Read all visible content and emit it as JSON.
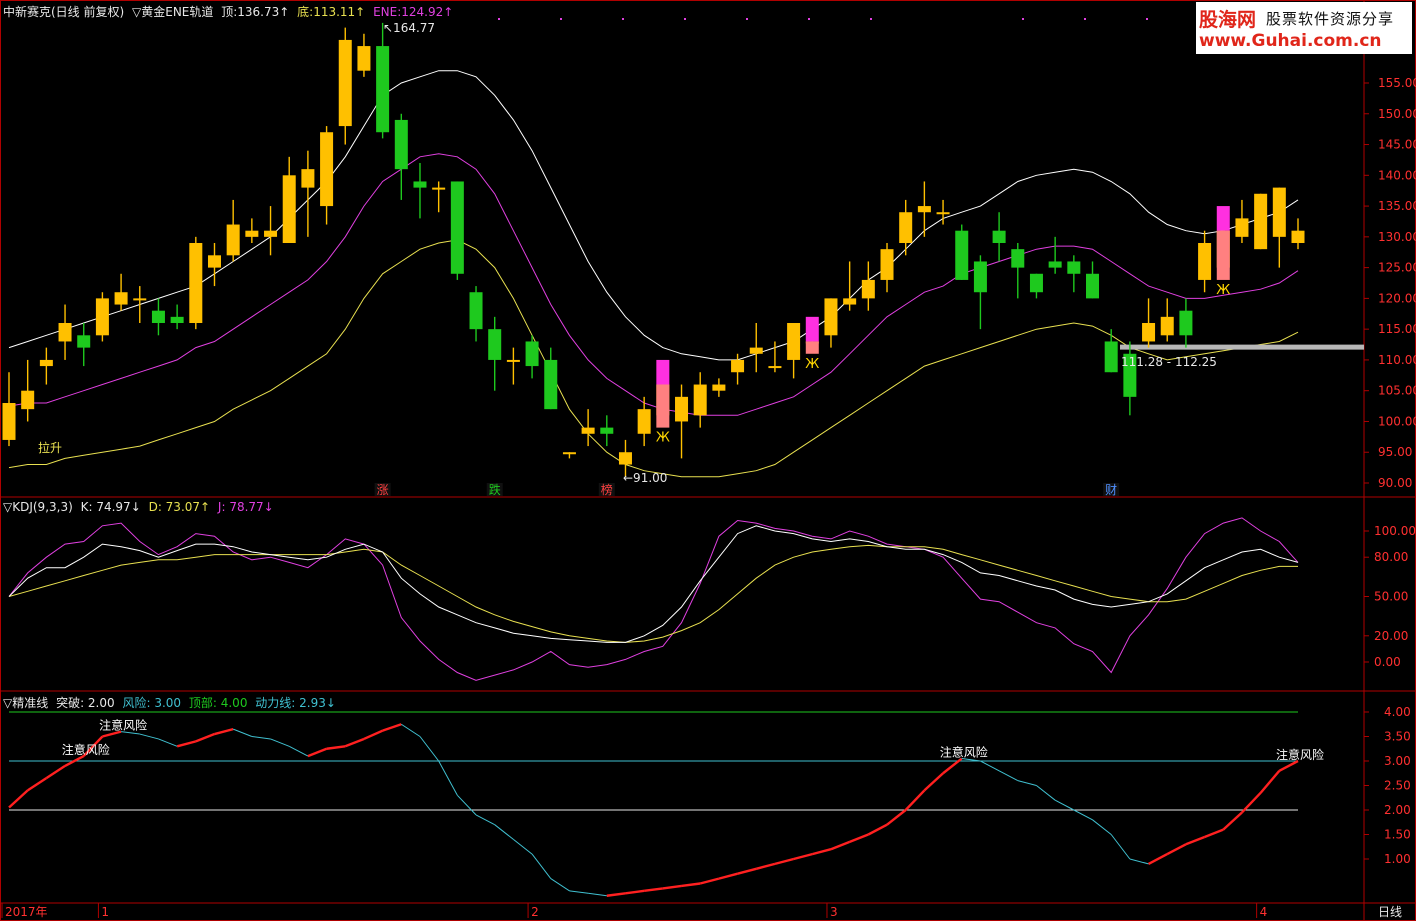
{
  "header": {
    "title": "中新赛克(日线 前复权)",
    "indicator": "▽黄金ENE轨道",
    "top_label": "顶:",
    "top_value": "136.73↑",
    "bottom_label": "底:",
    "bottom_value": "113.11↑",
    "ene_label": "ENE:",
    "ene_value": "124.92↑"
  },
  "logo": {
    "name": "股海网",
    "slogan": "股票软件资源分享",
    "url": "www.Guhai.com.cn"
  },
  "kdj_header": {
    "name": "▽KDJ(9,3,3)",
    "k": "K: 74.97↓",
    "d": "D: 73.07↑",
    "j": "J: 78.77↓"
  },
  "line_header": {
    "name": "▽精准线",
    "break": "突破: 2.00",
    "risk": "风险: 3.00",
    "top": "顶部: 4.00",
    "power": "动力线: 2.93↓"
  },
  "colors": {
    "up": "#ffc000",
    "down": "#1ec91e",
    "upper": "#ffffff",
    "mid": "#e040e0",
    "lower": "#e8e050",
    "kdj_k": "#ffffff",
    "kdj_d": "#e8e050",
    "kdj_j": "#e040e0",
    "line_up": "#ff2020",
    "line_down": "#40c0d0"
  },
  "chart_data": [
    {
      "type": "candlestick",
      "ylim": [
        88,
        165
      ],
      "yticks": [
        90,
        95,
        100,
        105,
        110,
        115,
        120,
        125,
        130,
        135,
        140,
        145,
        150,
        155
      ],
      "candles": [
        [
          97,
          103,
          96,
          108
        ],
        [
          102,
          105,
          100,
          110
        ],
        [
          109,
          110,
          106,
          112
        ],
        [
          113,
          116,
          110,
          119
        ],
        [
          114,
          112,
          109,
          116
        ],
        [
          114,
          120,
          113,
          121
        ],
        [
          119,
          121,
          118,
          124
        ],
        [
          120,
          120,
          116,
          122
        ],
        [
          118,
          116,
          114,
          120
        ],
        [
          117,
          116,
          115,
          119
        ],
        [
          116,
          129,
          115,
          130
        ],
        [
          125,
          127,
          122,
          129
        ],
        [
          127,
          132,
          126,
          136
        ],
        [
          130,
          131,
          129,
          133
        ],
        [
          130,
          131,
          127,
          135
        ],
        [
          129,
          140,
          129,
          143
        ],
        [
          138,
          141,
          130,
          144
        ],
        [
          135,
          147,
          132,
          148
        ],
        [
          148,
          162,
          145,
          164
        ],
        [
          157,
          161,
          156,
          163
        ],
        [
          161,
          147,
          146,
          164.77
        ],
        [
          149,
          141,
          136,
          150
        ],
        [
          139,
          138,
          133,
          142
        ],
        [
          138,
          138,
          134,
          139
        ],
        [
          139,
          124,
          123,
          139
        ],
        [
          121,
          115,
          113,
          122
        ],
        [
          115,
          110,
          105,
          117
        ],
        [
          110,
          110,
          106,
          112
        ],
        [
          113,
          109,
          107,
          114
        ],
        [
          110,
          102,
          102,
          112
        ],
        [
          95,
          95,
          94,
          95
        ],
        [
          98,
          99,
          96,
          102
        ],
        [
          99,
          98,
          96,
          101
        ],
        [
          93,
          95,
          91,
          97
        ],
        [
          98,
          102,
          96,
          104
        ],
        [
          101,
          106,
          100,
          106
        ],
        [
          100,
          104,
          94,
          106
        ],
        [
          101,
          106,
          99,
          108
        ],
        [
          105,
          106,
          104,
          107
        ],
        [
          108,
          110,
          106,
          111
        ],
        [
          111,
          112,
          108,
          116
        ],
        [
          109,
          109,
          108,
          113
        ],
        [
          110,
          116,
          107,
          116
        ],
        [
          113,
          113,
          112,
          114
        ],
        [
          114,
          120,
          112,
          120
        ],
        [
          119,
          120,
          118,
          126
        ],
        [
          120,
          123,
          118,
          126
        ],
        [
          123,
          128,
          121,
          129
        ],
        [
          129,
          134,
          127,
          136
        ],
        [
          134,
          135,
          130,
          139
        ],
        [
          134,
          134,
          132,
          136
        ],
        [
          131,
          123,
          123,
          132
        ],
        [
          126,
          121,
          115,
          127
        ],
        [
          131,
          129,
          126,
          134
        ],
        [
          128,
          125,
          120,
          129
        ],
        [
          124,
          121,
          120,
          124
        ],
        [
          126,
          125,
          124,
          130
        ],
        [
          126,
          124,
          121,
          127
        ],
        [
          124,
          120,
          120,
          126
        ],
        [
          113,
          108,
          108,
          115
        ],
        [
          111,
          104,
          101,
          113
        ],
        [
          113,
          116,
          112,
          120
        ],
        [
          114,
          117,
          113,
          120
        ],
        [
          118,
          114,
          112,
          120
        ],
        [
          123,
          129,
          121,
          131
        ],
        [
          125,
          131,
          124,
          132
        ],
        [
          130,
          133,
          129,
          136
        ],
        [
          128,
          137,
          128,
          137
        ],
        [
          130,
          138,
          125,
          138
        ],
        [
          129,
          131,
          128,
          133
        ]
      ],
      "upper_line": [
        112,
        113,
        114,
        115,
        116,
        117,
        118,
        119,
        120,
        121,
        122,
        124,
        126,
        128,
        130,
        133,
        136,
        139,
        143,
        148,
        153,
        155,
        156,
        157,
        157,
        156,
        153,
        149,
        144,
        138,
        132,
        126,
        121,
        117,
        114,
        112,
        111,
        110.5,
        110,
        110,
        111,
        112,
        113,
        115,
        117,
        120,
        123,
        125,
        128,
        131,
        133,
        134,
        135,
        137,
        139,
        140,
        140.5,
        141,
        140.5,
        139,
        137,
        134,
        132,
        131,
        130.5,
        131,
        132,
        133,
        134,
        136
      ],
      "mid_line": [
        102.5,
        103,
        103,
        104,
        105,
        106,
        107,
        108,
        109,
        110,
        112,
        113,
        115,
        117,
        119,
        121,
        123,
        126,
        130,
        135,
        139,
        141,
        143,
        143.5,
        143,
        141,
        137,
        131,
        125,
        119,
        114,
        110,
        107,
        105,
        103,
        102,
        101.5,
        101,
        101,
        101,
        102,
        103,
        104,
        106,
        108,
        111,
        114,
        117,
        119,
        121,
        122,
        124,
        125,
        126,
        127,
        128,
        128.5,
        128.5,
        128,
        126,
        124,
        122,
        121,
        120,
        120,
        120.5,
        121,
        121.5,
        122.5,
        124.5
      ],
      "lower_line": [
        92.5,
        93,
        93,
        94,
        94.5,
        95,
        95.5,
        96,
        97,
        98,
        99,
        100,
        102,
        103.5,
        105,
        107,
        109,
        111,
        115,
        120,
        124,
        126,
        128,
        129,
        129.5,
        128,
        125,
        120,
        114,
        108,
        102,
        98,
        95,
        93,
        92,
        91.5,
        91,
        91,
        91,
        91.5,
        92,
        93,
        95,
        97,
        99,
        101,
        103,
        105,
        107,
        109,
        110,
        111,
        112,
        113,
        114,
        115,
        115.5,
        116,
        115.5,
        114,
        112,
        111,
        110,
        110.5,
        111,
        111.5,
        112,
        112.5,
        113,
        114.5
      ],
      "annotations": {
        "high": "164.77",
        "low": "91.00",
        "range": "111.28 - 112.25",
        "lasheng": "拉升"
      },
      "markers": [
        {
          "index": 20,
          "text": "涨"
        },
        {
          "index": 26,
          "text": "跌"
        },
        {
          "index": 32,
          "text": "榜"
        },
        {
          "index": 59,
          "text": "财"
        }
      ],
      "support_level": 112
    },
    {
      "type": "line",
      "name": "KDJ",
      "ylim": [
        -15,
        115
      ],
      "yticks": [
        0,
        20,
        50,
        80,
        100
      ],
      "tick_labels": [
        "0.00",
        "20.00",
        "50.00",
        "80.00",
        "100.00"
      ],
      "k": [
        50,
        64,
        72,
        72,
        80,
        90,
        88,
        85,
        80,
        85,
        90,
        90,
        88,
        84,
        82,
        80,
        78,
        80,
        86,
        90,
        84,
        64,
        52,
        42,
        36,
        30,
        26,
        22,
        20,
        18,
        17,
        16,
        15,
        15,
        20,
        28,
        42,
        62,
        80,
        98,
        104,
        100,
        98,
        94,
        92,
        94,
        92,
        88,
        86,
        86,
        82,
        76,
        68,
        66,
        62,
        58,
        55,
        48,
        44,
        42,
        44,
        46,
        52,
        62,
        72,
        78,
        84,
        86,
        80,
        76
      ],
      "d": [
        50,
        54,
        58,
        62,
        66,
        70,
        74,
        76,
        78,
        78,
        80,
        82,
        82,
        82,
        82,
        82,
        82,
        82,
        84,
        86,
        84,
        74,
        66,
        58,
        50,
        42,
        36,
        31,
        27,
        23,
        20,
        18,
        16,
        15,
        16,
        19,
        24,
        30,
        40,
        52,
        64,
        74,
        80,
        84,
        86,
        88,
        89,
        88,
        88,
        88,
        86,
        82,
        78,
        74,
        70,
        66,
        62,
        58,
        54,
        50,
        48,
        46,
        46,
        48,
        54,
        60,
        66,
        70,
        73,
        73
      ],
      "j": [
        50,
        68,
        80,
        90,
        92,
        104,
        106,
        92,
        82,
        88,
        98,
        96,
        84,
        78,
        80,
        76,
        72,
        82,
        94,
        90,
        74,
        34,
        16,
        2,
        -8,
        -14,
        -10,
        -6,
        0,
        8,
        -2,
        -4,
        -2,
        2,
        8,
        12,
        30,
        60,
        96,
        108,
        106,
        102,
        100,
        96,
        94,
        100,
        96,
        90,
        88,
        86,
        80,
        64,
        48,
        46,
        38,
        30,
        26,
        14,
        8,
        -8,
        20,
        36,
        56,
        80,
        98,
        106,
        110,
        100,
        92,
        76
      ]
    },
    {
      "type": "line",
      "name": "精准线",
      "ylim": [
        0,
        4.3
      ],
      "yticks": [
        1,
        1.5,
        2,
        2.5,
        3,
        3.5,
        4
      ],
      "tick_labels": [
        "1.00",
        "1.50",
        "2.00",
        "2.50",
        "3.00",
        "3.50",
        "4.00"
      ],
      "levels": {
        "break": 2.0,
        "risk": 3.0,
        "top": 4.0
      },
      "power_line": [
        2.05,
        2.4,
        2.65,
        2.9,
        3.1,
        3.5,
        3.6,
        3.55,
        3.45,
        3.3,
        3.4,
        3.55,
        3.65,
        3.5,
        3.45,
        3.3,
        3.1,
        3.25,
        3.3,
        3.45,
        3.62,
        3.75,
        3.5,
        3.0,
        2.3,
        1.9,
        1.7,
        1.4,
        1.1,
        0.6,
        0.35,
        0.3,
        0.25,
        0.3,
        0.35,
        0.4,
        0.45,
        0.5,
        0.6,
        0.7,
        0.8,
        0.9,
        1.0,
        1.1,
        1.2,
        1.35,
        1.5,
        1.7,
        2.0,
        2.4,
        2.75,
        3.05,
        3.0,
        2.8,
        2.6,
        2.5,
        2.2,
        2.0,
        1.8,
        1.5,
        1.0,
        0.9,
        1.1,
        1.3,
        1.45,
        1.6,
        1.95,
        2.35,
        2.8,
        3.0
      ],
      "warnings": [
        {
          "index": 4,
          "text": "注意风险"
        },
        {
          "index": 6,
          "text": "注意风险"
        },
        {
          "index": 51,
          "text": "注意风险"
        },
        {
          "index": 69,
          "text": "注意风险"
        }
      ]
    }
  ],
  "x_axis": {
    "labels": [
      {
        "index": 0,
        "text": "2017年"
      },
      {
        "index": 5,
        "text": "1"
      },
      {
        "index": 28,
        "text": "2"
      },
      {
        "index": 44,
        "text": "3"
      },
      {
        "index": 67,
        "text": "4"
      }
    ],
    "period": "日线"
  }
}
